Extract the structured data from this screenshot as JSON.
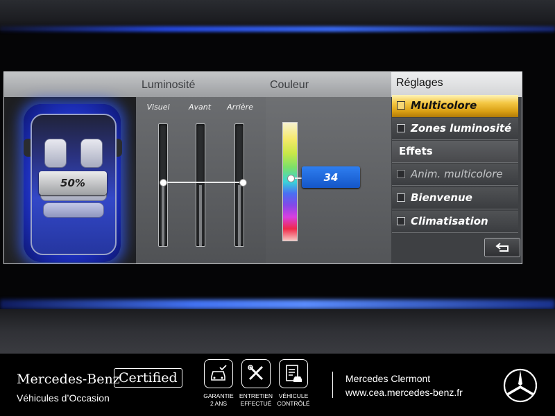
{
  "screen": {
    "headers": {
      "luminosite": "Luminosité",
      "couleur": "Couleur",
      "reglages": "Réglages"
    },
    "luminosite": {
      "labels": [
        "Visuel",
        "Avant",
        "Arrière"
      ],
      "value": "50%",
      "level": 0.5
    },
    "couleur": {
      "value": "34"
    },
    "menu": {
      "items": [
        {
          "label": "Multicolore",
          "checked": false,
          "selected": true
        },
        {
          "label": "Zones luminosité",
          "checked": false
        }
      ],
      "section": "Effets",
      "effects": [
        {
          "label": "Anim. multicolore",
          "checked": false,
          "disabled": true
        },
        {
          "label": "Bienvenue",
          "checked": false
        },
        {
          "label": "Climatisation",
          "checked": false
        }
      ]
    },
    "back_icon": "return-arrow-icon",
    "ambient_color": "#3a5cff"
  },
  "footer": {
    "brand": "Mercedes-Benz",
    "certified": "Certified",
    "subtitle": "Véhicules d’Occasion",
    "badges": [
      {
        "icon": "car-check-icon",
        "label": "GARANTIE\n2 ANS"
      },
      {
        "icon": "tools-icon",
        "label": "ENTRETIEN\nEFFECTUÉ"
      },
      {
        "icon": "checklist-car-icon",
        "label": "VÉHICULE\nCONTRÔLÉ"
      }
    ],
    "dealer": "Mercedes Clermont",
    "url": "www.cea.mercedes-benz.fr",
    "logo_icon": "mercedes-star-icon"
  }
}
